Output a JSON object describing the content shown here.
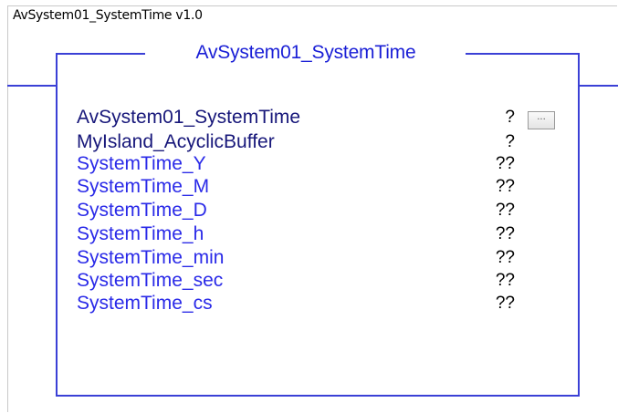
{
  "header": {
    "instruction_label": "AvSystem01_SystemTime v1.0"
  },
  "block": {
    "title": "AvSystem01_SystemTime",
    "browse_label": "...",
    "params": [
      {
        "name": "AvSystem01_SystemTime",
        "value": "?",
        "kind": "input"
      },
      {
        "name": "MyIsland_AcyclicBuffer",
        "value": "?",
        "kind": "input"
      },
      {
        "name": "SystemTime_Y",
        "value": "??",
        "kind": "output"
      },
      {
        "name": "SystemTime_M",
        "value": "??",
        "kind": "output"
      },
      {
        "name": "SystemTime_D",
        "value": "??",
        "kind": "output"
      },
      {
        "name": "SystemTime_h",
        "value": "??",
        "kind": "output"
      },
      {
        "name": "SystemTime_min",
        "value": "??",
        "kind": "output"
      },
      {
        "name": "SystemTime_sec",
        "value": "??",
        "kind": "output"
      },
      {
        "name": "SystemTime_cs",
        "value": "??",
        "kind": "output"
      }
    ]
  },
  "colors": {
    "rung": "#3b40d6",
    "title": "#1a1fd6",
    "input_param": "#17177a",
    "output_param": "#2a2ae8"
  }
}
